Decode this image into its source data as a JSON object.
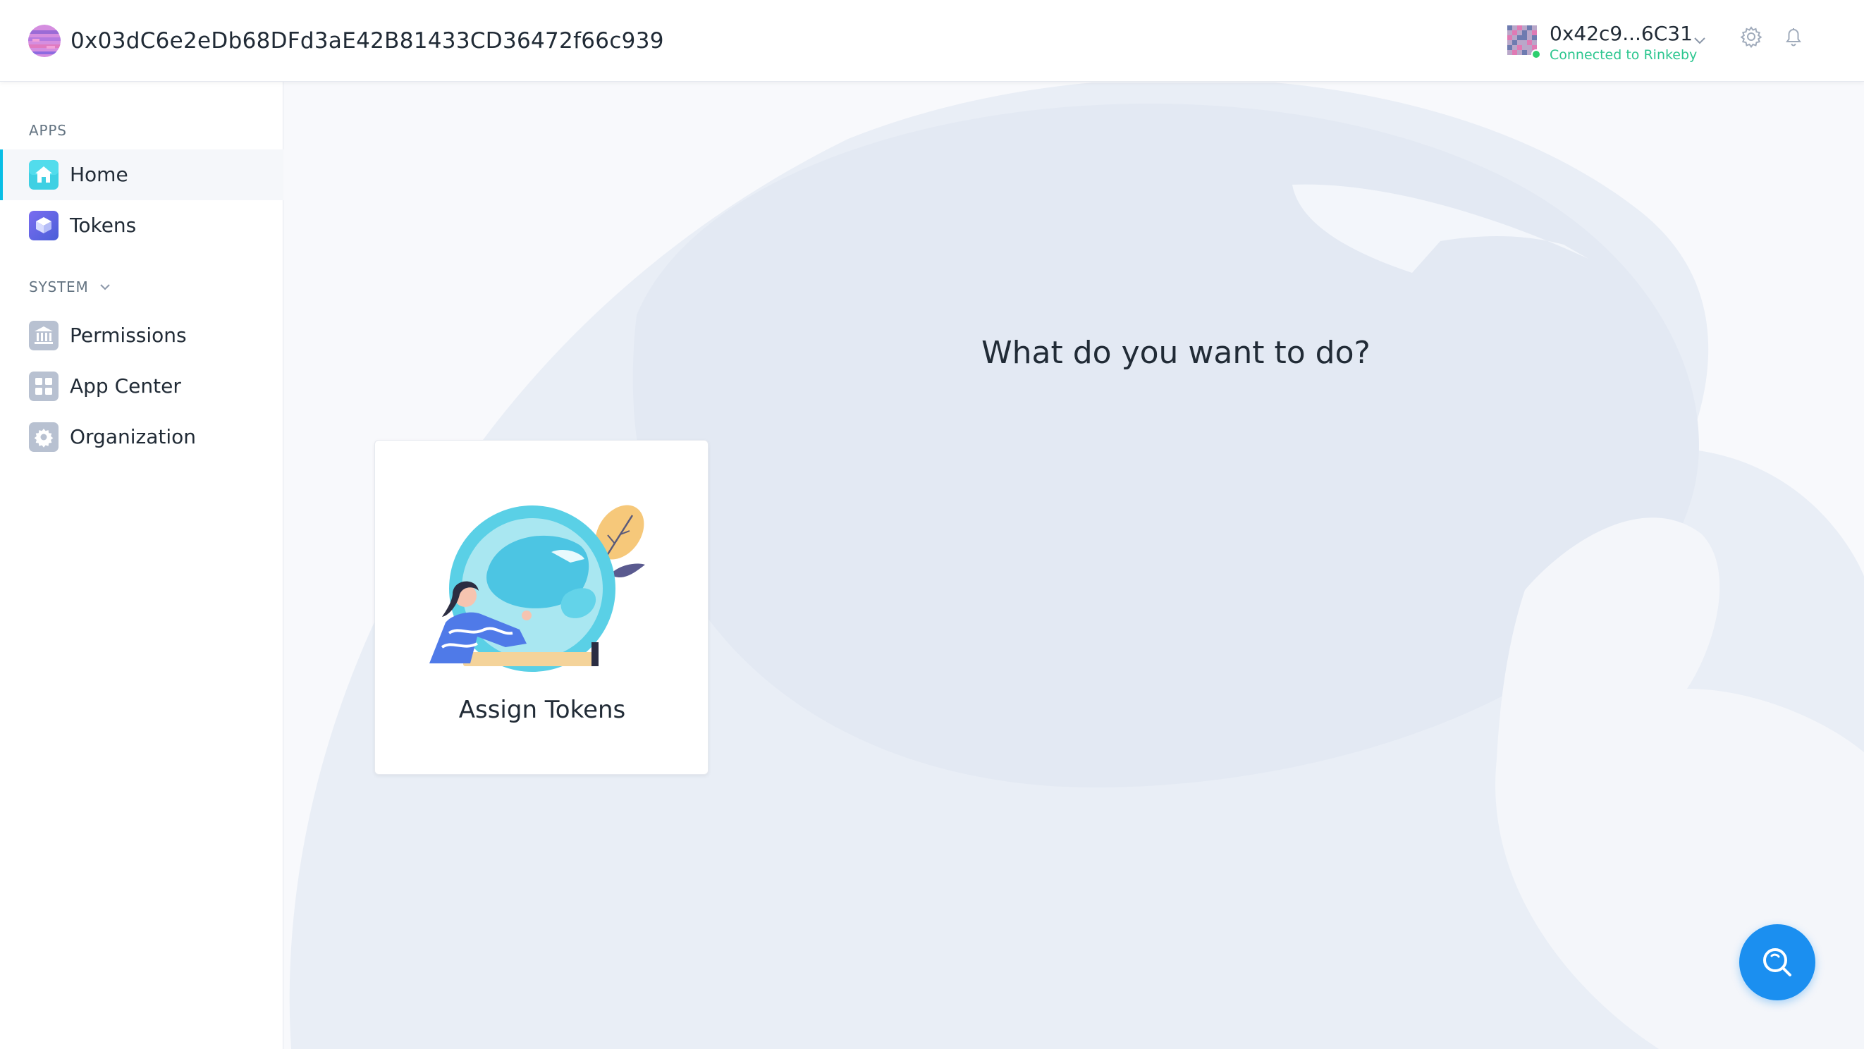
{
  "header": {
    "org_address": "0x03dC6e2eDb68DFd3aE42B81433CD36472f66c939",
    "account": {
      "address": "0x42c9...6C31",
      "network_status": "Connected to Rinkeby"
    },
    "icons": [
      "gear-icon",
      "bell-icon"
    ]
  },
  "sidebar": {
    "apps_label": "APPS",
    "system_label": "SYSTEM",
    "apps": [
      {
        "label": "Home",
        "icon": "home-icon",
        "active": true
      },
      {
        "label": "Tokens",
        "icon": "tokens-icon",
        "active": false
      }
    ],
    "system": [
      {
        "label": "Permissions",
        "icon": "bank-icon"
      },
      {
        "label": "App Center",
        "icon": "grid-icon"
      },
      {
        "label": "Organization",
        "icon": "cog-icon"
      }
    ]
  },
  "main": {
    "title": "What do you want to do?",
    "actions": [
      {
        "label": "Assign Tokens",
        "illustration": "assign-tokens-illustration"
      }
    ]
  },
  "help_button": {
    "icon": "help-search-icon"
  },
  "colors": {
    "accent": "#08bee5",
    "network_green": "#2cc68f",
    "help_blue": "#1b8ff0",
    "background": "#f8f9fc",
    "bg_shape": "#e9eef6"
  }
}
